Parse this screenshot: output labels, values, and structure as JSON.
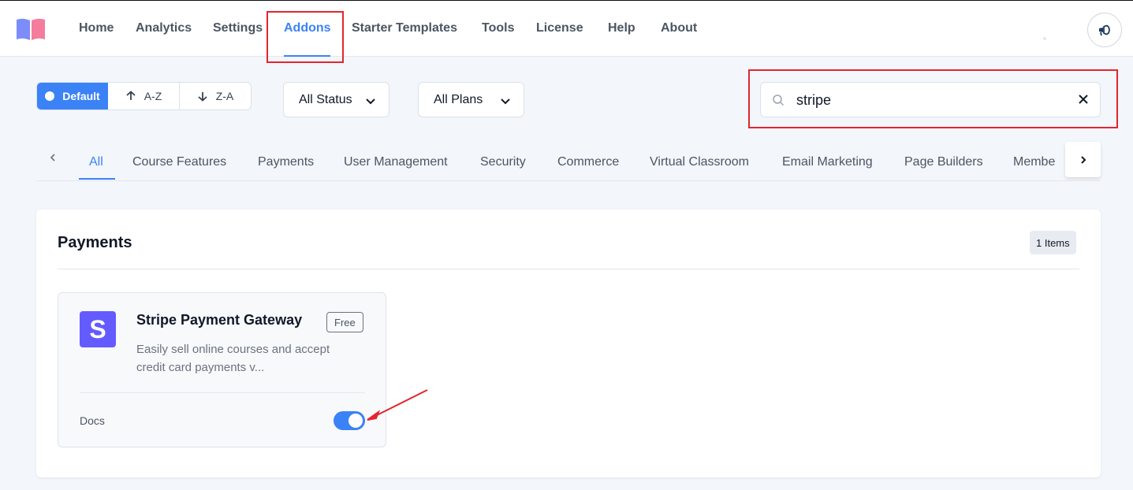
{
  "nav": {
    "items": [
      "Home",
      "Analytics",
      "Settings",
      "Addons",
      "Starter Templates",
      "Tools",
      "License",
      "Help",
      "About"
    ],
    "active": "Addons"
  },
  "sort": {
    "default_label": "Default",
    "az_label": "A-Z",
    "za_label": "Z-A"
  },
  "filters": {
    "status_label": "All Status",
    "plans_label": "All Plans"
  },
  "search": {
    "value": "stripe"
  },
  "tabs": [
    "All",
    "Course Features",
    "Payments",
    "User Management",
    "Security",
    "Commerce",
    "Virtual Classroom",
    "Email Marketing",
    "Page Builders",
    "Membe"
  ],
  "section": {
    "title": "Payments",
    "count_badge": "1 Items",
    "card": {
      "icon_letter": "S",
      "title": "Stripe Payment Gateway",
      "badge": "Free",
      "description": "Easily sell online courses and accept credit card payments v...",
      "docs_label": "Docs",
      "enabled": true
    }
  },
  "colors": {
    "accent": "#3b82f6",
    "stripe": "#635bff",
    "highlight": "#e3262d"
  }
}
